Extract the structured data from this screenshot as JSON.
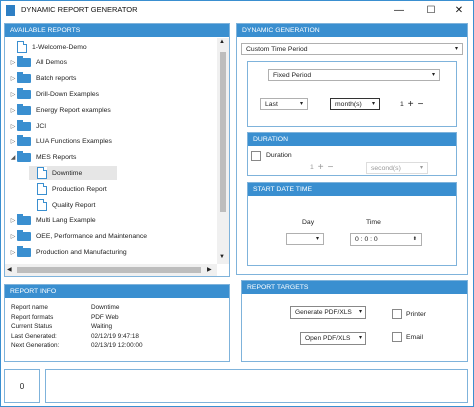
{
  "window": {
    "title": "DYNAMIC REPORT GENERATOR",
    "min_glyph": "—",
    "max_glyph": "☐",
    "close_glyph": "✕"
  },
  "reports": {
    "header": "AVAILABLE REPORTS",
    "items": [
      {
        "label": "1-Welcome-Demo",
        "kind": "doc",
        "indent": 0,
        "arrow": ""
      },
      {
        "label": "All Demos",
        "kind": "folder",
        "indent": 0,
        "arrow": "▷"
      },
      {
        "label": "Batch reports",
        "kind": "folder",
        "indent": 0,
        "arrow": "▷"
      },
      {
        "label": "Drill-Down Examples",
        "kind": "folder",
        "indent": 0,
        "arrow": "▷"
      },
      {
        "label": "Energy Report examples",
        "kind": "folder",
        "indent": 0,
        "arrow": "▷"
      },
      {
        "label": "JCI",
        "kind": "folder",
        "indent": 0,
        "arrow": "▷"
      },
      {
        "label": "LUA Functions Examples",
        "kind": "folder",
        "indent": 0,
        "arrow": "▷"
      },
      {
        "label": "MES Reports",
        "kind": "folder",
        "indent": 0,
        "arrow": "◢"
      },
      {
        "label": "Downtime",
        "kind": "doc",
        "indent": 1,
        "arrow": "",
        "selected": true
      },
      {
        "label": "Production Report",
        "kind": "doc",
        "indent": 1,
        "arrow": ""
      },
      {
        "label": "Quality Report",
        "kind": "doc",
        "indent": 1,
        "arrow": ""
      },
      {
        "label": "Multi Lang Example",
        "kind": "folder",
        "indent": 0,
        "arrow": "▷"
      },
      {
        "label": "OEE, Performance and Maintenance",
        "kind": "folder",
        "indent": 0,
        "arrow": "▷"
      },
      {
        "label": "Production and Manufacturing",
        "kind": "folder",
        "indent": 0,
        "arrow": "▷"
      }
    ],
    "scroll_up": "▲",
    "scroll_down": "▼",
    "scroll_left": "◀",
    "scroll_right": "▶"
  },
  "generation": {
    "header": "DYNAMIC GENERATION",
    "mode": "Custom Time Period",
    "period_type": "Fixed Period",
    "relative": "Last",
    "unit": "month(s)",
    "count": "1",
    "plus": "+",
    "minus": "−",
    "caret": "▾"
  },
  "duration": {
    "header": "DURATION",
    "label": "Duration",
    "count": "1",
    "unit": "second(s)"
  },
  "start": {
    "header": "START DATE TIME",
    "day_label": "Day",
    "time_label": "Time",
    "time_value": "0 : 0 : 0"
  },
  "info": {
    "header": "REPORT INFO",
    "rows": [
      {
        "k": "Report name",
        "v": "Downtime"
      },
      {
        "k": "Report formats",
        "v": "PDF Web"
      },
      {
        "k": "Current Status",
        "v": "Waiting"
      },
      {
        "k": "Last Generated:",
        "v": "02/12/19 9:47:18"
      },
      {
        "k": "Next Generation:",
        "v": "02/13/19 12:00:00"
      }
    ]
  },
  "targets": {
    "header": "REPORT TARGETS",
    "generate_label": "Generate PDF/XLS",
    "open_label": "Open PDF/XLS",
    "printer_label": "Printer",
    "email_label": "Email"
  },
  "footer": {
    "count": "0"
  }
}
